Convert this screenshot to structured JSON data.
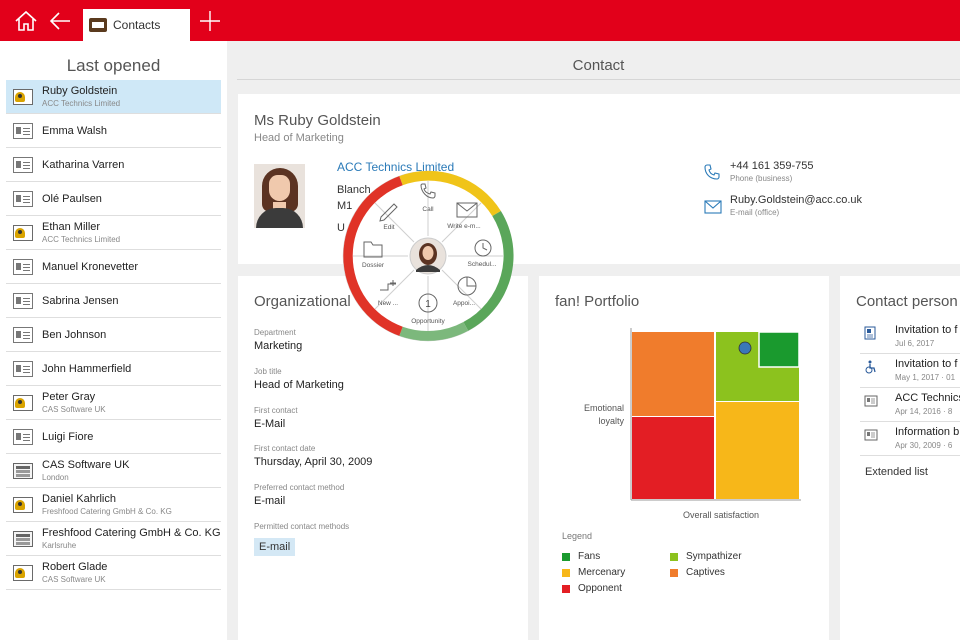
{
  "topbar": {
    "tab_label": "Contacts",
    "icons": [
      "home-icon",
      "back-arrow-icon",
      "contact-card-icon",
      "plus-icon"
    ]
  },
  "sidebar": {
    "title": "Last opened",
    "items": [
      {
        "name": "Ruby Goldstein",
        "sub": "ACC Technics Limited",
        "type": "person",
        "active": true
      },
      {
        "name": "Emma Walsh",
        "sub": "",
        "type": "card"
      },
      {
        "name": "Katharina Varren",
        "sub": "",
        "type": "card"
      },
      {
        "name": "Olé Paulsen",
        "sub": "",
        "type": "card"
      },
      {
        "name": "Ethan Miller",
        "sub": "ACC Technics Limited",
        "type": "person"
      },
      {
        "name": "Manuel Kronevetter",
        "sub": "",
        "type": "card"
      },
      {
        "name": "Sabrina Jensen",
        "sub": "",
        "type": "card"
      },
      {
        "name": "Ben Johnson",
        "sub": "",
        "type": "card"
      },
      {
        "name": "John Hammerfield",
        "sub": "",
        "type": "card"
      },
      {
        "name": "Peter Gray",
        "sub": "CAS Software UK",
        "type": "person"
      },
      {
        "name": "Luigi Fiore",
        "sub": "",
        "type": "card"
      },
      {
        "name": "CAS Software UK",
        "sub": "London",
        "type": "company"
      },
      {
        "name": "Daniel Kahrlich",
        "sub": "Freshfood Catering GmbH & Co. KG",
        "type": "person"
      },
      {
        "name": "Freshfood Catering GmbH & Co. KG",
        "sub": "Karlsruhe",
        "type": "company"
      },
      {
        "name": "Robert Glade",
        "sub": "CAS Software UK",
        "type": "person"
      }
    ]
  },
  "main": {
    "title": "Contact"
  },
  "contact": {
    "name": "Ms Ruby Goldstein",
    "job": "Head of Marketing",
    "company": "ACC Technics Limited",
    "addr1": "Blanch",
    "addr2": "M1",
    "addr3": "U",
    "phone": "+44 161 359-755",
    "phone_label": "Phone (business)",
    "email": "Ruby.Goldstein@acc.co.uk",
    "email_label": "E-mail (office)"
  },
  "org": {
    "title": "Organizational",
    "fields": [
      {
        "label": "Department",
        "value": "Marketing"
      },
      {
        "label": "Job title",
        "value": "Head of Marketing"
      },
      {
        "label": "First contact",
        "value": "E-Mail"
      },
      {
        "label": "First contact date",
        "value": "Thursday, April 30, 2009"
      },
      {
        "label": "Preferred contact method",
        "value": "E-mail"
      }
    ],
    "permitted_label": "Permitted contact methods",
    "permitted_chip": "E-mail"
  },
  "portfolio": {
    "title": "fan! Portfolio",
    "ylabel_1": "Emotional",
    "ylabel_2": "loyalty",
    "xlabel": "Overall satisfaction",
    "legend_title": "Legend",
    "legend": [
      {
        "label": "Fans",
        "color": "#1a9a2e"
      },
      {
        "label": "Sympathizer",
        "color": "#8cc21e"
      },
      {
        "label": "Mercenary",
        "color": "#f7b719"
      },
      {
        "label": "Captives",
        "color": "#f07c2c"
      },
      {
        "label": "Opponent",
        "color": "#e31e24"
      }
    ],
    "marker_color": "#3a78b8"
  },
  "contact_persons": {
    "title": "Contact person",
    "items": [
      {
        "name": "Invitation to f",
        "date": "Jul 6, 2017",
        "icon": "document-icon"
      },
      {
        "name": "Invitation to f",
        "date": "May 1, 2017 · 01",
        "icon": "wheelchair-icon"
      },
      {
        "name": "ACC Technics",
        "date": "Apr 14, 2016 · 8",
        "icon": "card-icon"
      },
      {
        "name": "Information b",
        "date": "Apr 30, 2009 · 6",
        "icon": "card-icon"
      }
    ],
    "extended": "Extended list"
  },
  "wheel": {
    "actions": [
      "Call",
      "Write e-m...",
      "Schedul...",
      "Appoi...",
      "Opportunity",
      "New ...",
      "Dossier",
      "Edit"
    ],
    "opportunity_number": "1",
    "ring_colors": [
      "#f0c419",
      "#5aa65a",
      "#7cb87c",
      "#e03327"
    ]
  },
  "colors": {
    "brand": "#e2001a",
    "link": "#2a7ab8"
  }
}
